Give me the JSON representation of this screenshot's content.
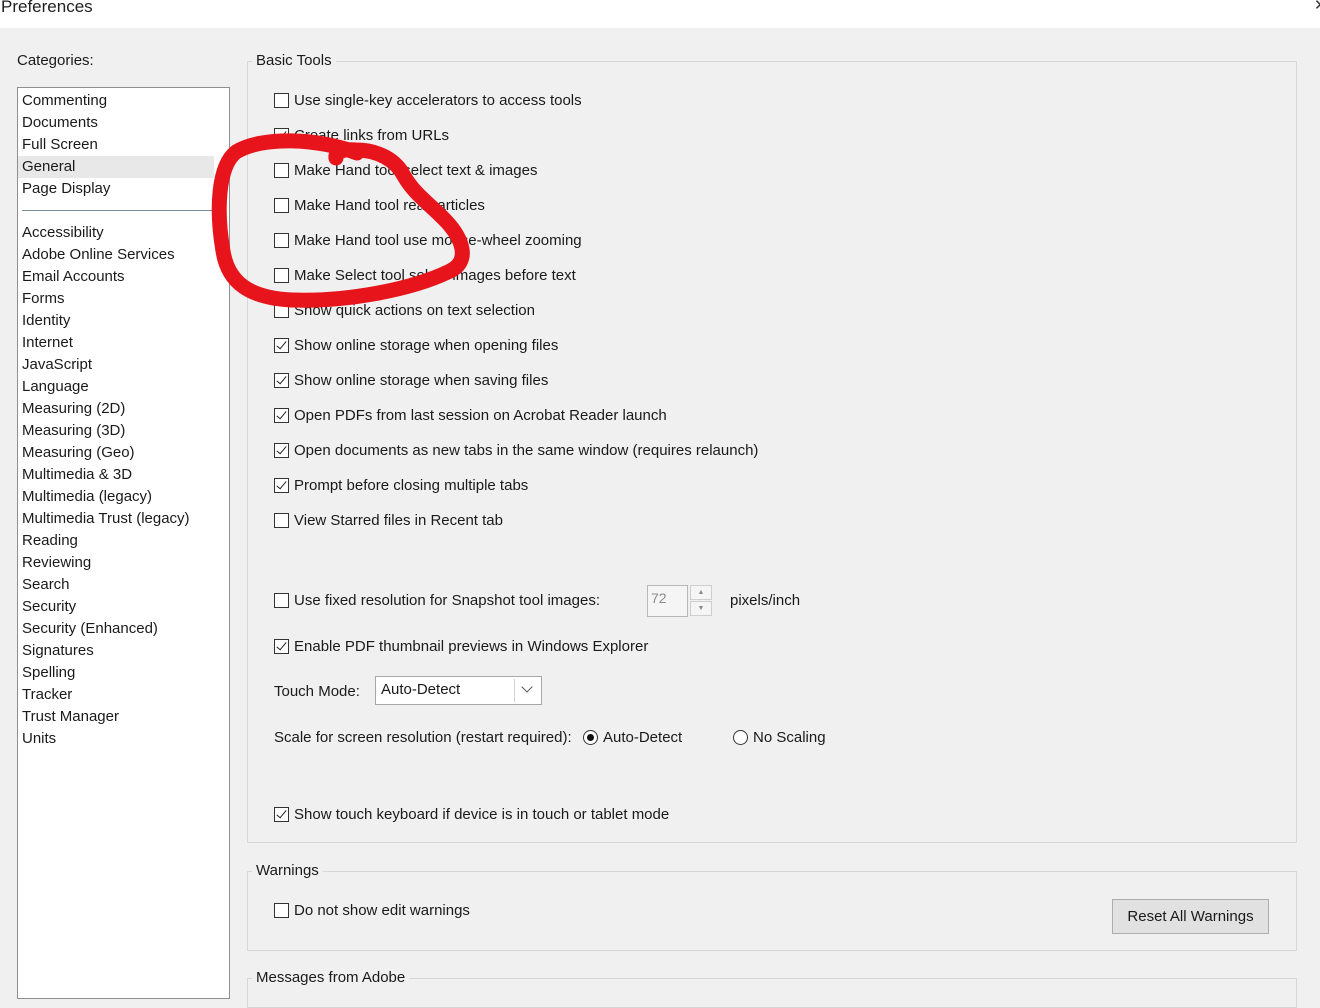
{
  "window": {
    "title": "Preferences",
    "close_glyph": "✕"
  },
  "categories": {
    "label": "Categories:",
    "top_items": [
      "Commenting",
      "Documents",
      "Full Screen",
      "General",
      "Page Display"
    ],
    "selected": "General",
    "items": [
      "Accessibility",
      "Adobe Online Services",
      "Email Accounts",
      "Forms",
      "Identity",
      "Internet",
      "JavaScript",
      "Language",
      "Measuring (2D)",
      "Measuring (3D)",
      "Measuring (Geo)",
      "Multimedia & 3D",
      "Multimedia (legacy)",
      "Multimedia Trust (legacy)",
      "Reading",
      "Reviewing",
      "Search",
      "Security",
      "Security (Enhanced)",
      "Signatures",
      "Spelling",
      "Tracker",
      "Trust Manager",
      "Units"
    ]
  },
  "basic_tools": {
    "title": "Basic Tools",
    "options": [
      {
        "label": "Use single-key accelerators to access tools",
        "checked": false
      },
      {
        "label": "Create links from URLs",
        "checked": true
      },
      {
        "label": "Make Hand tool select text & images",
        "checked": false
      },
      {
        "label": "Make Hand tool read articles",
        "checked": false
      },
      {
        "label": "Make Hand tool use mouse-wheel zooming",
        "checked": false
      },
      {
        "label": "Make Select tool select images before text",
        "checked": false
      },
      {
        "label": "Show quick actions on text selection",
        "checked": false
      },
      {
        "label": "Show online storage when opening files",
        "checked": true
      },
      {
        "label": "Show online storage when saving files",
        "checked": true
      },
      {
        "label": "Open PDFs from last session on Acrobat Reader launch",
        "checked": true
      },
      {
        "label": "Open documents as new tabs in the same window (requires relaunch)",
        "checked": true
      },
      {
        "label": "Prompt before closing multiple tabs",
        "checked": true
      },
      {
        "label": "View Starred files in Recent tab",
        "checked": false
      }
    ],
    "snapshot": {
      "label": "Use fixed resolution for Snapshot tool images:",
      "checked": false,
      "value": "72",
      "unit": "pixels/inch"
    },
    "thumbnails": {
      "label": "Enable PDF thumbnail previews in Windows Explorer",
      "checked": true
    },
    "touch_mode": {
      "label": "Touch Mode:",
      "value": "Auto-Detect"
    },
    "scale": {
      "label": "Scale for screen resolution (restart required):",
      "option_auto": "Auto-Detect",
      "option_none": "No Scaling",
      "selected": "Auto-Detect"
    },
    "touch_keyboard": {
      "label": "Show touch keyboard if device is in touch or tablet mode",
      "checked": true
    }
  },
  "warnings": {
    "title": "Warnings",
    "no_edit_warnings": {
      "label": "Do not show edit warnings",
      "checked": false
    },
    "reset_button": "Reset All Warnings"
  },
  "messages": {
    "title": "Messages from Adobe"
  },
  "colors": {
    "annotation": "#e8141c",
    "background": "#f0f0f0",
    "selected_item": "#e8e8e8"
  }
}
